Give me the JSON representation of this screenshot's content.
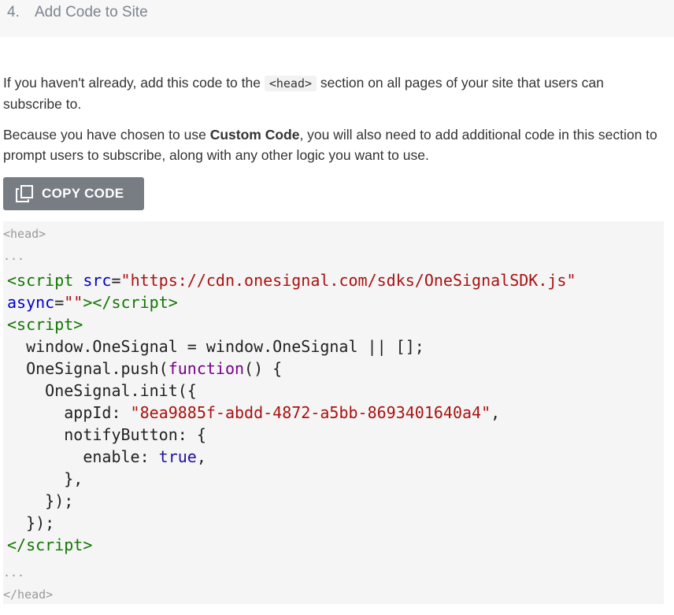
{
  "step": {
    "number": "4.",
    "title": "Add Code to Site"
  },
  "para1": {
    "before": "If you haven't already, add this code to the ",
    "code": "<head>",
    "after": " section on all pages of your site that users can subscribe to."
  },
  "para2": {
    "before": "Because you have chosen to use ",
    "bold": "Custom Code",
    "after": ", you will also need to add additional code in this section to prompt users to subscribe, along with any other logic you want to use."
  },
  "copy_button": {
    "label": "COPY CODE",
    "icon": "copy-icon"
  },
  "code_block": {
    "head_open": "<head>",
    "ellipsis_top": "...",
    "ellipsis_bottom": "...",
    "head_close": "</head>",
    "script_src_url": "https://cdn.onesignal.com/sdks/OneSignalSDK.js",
    "app_id": "8ea9885f-abdd-4872-a5bb-8693401640a4"
  },
  "colors": {
    "header_bg": "#f7f7f7",
    "button_bg": "#787d83",
    "code_bg": "#f5f5f5",
    "tag": "#117700",
    "attr": "#0000cc",
    "string": "#aa1111",
    "keyword": "#770088"
  }
}
